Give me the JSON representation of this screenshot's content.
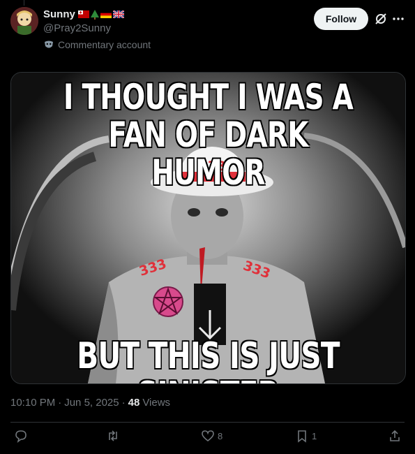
{
  "author": {
    "name": "Sunny",
    "handle": "@Pray2Sunny",
    "label": "Commentary account",
    "flag_icons": [
      "tonga-flag-icon",
      "tree-icon",
      "germany-flag-icon",
      "uk-flag-icon"
    ]
  },
  "header": {
    "follow_label": "Follow"
  },
  "media": {
    "caption_top_line1": "I THOUGHT I WAS A",
    "caption_top_line2": "FAN OF DARK HUMOR",
    "caption_bottom": "BUT THIS IS JUST SINISTER",
    "hat_text": "333",
    "shoulder_left_text": "333",
    "shoulder_right_text": "333"
  },
  "meta": {
    "time": "10:10 PM",
    "separator1": "·",
    "date": "Jun 5, 2025",
    "separator2": "·",
    "views_count": "48",
    "views_label": "Views"
  },
  "actions": {
    "reply_count": "",
    "repost_count": "",
    "like_count": "8",
    "bookmark_count": "1"
  },
  "colors": {
    "background": "#000000",
    "text_primary": "#e7e9ea",
    "text_secondary": "#71767b",
    "follow_bg": "#eff3f4",
    "border": "#2f3336",
    "accent_red": "#e0303a"
  }
}
